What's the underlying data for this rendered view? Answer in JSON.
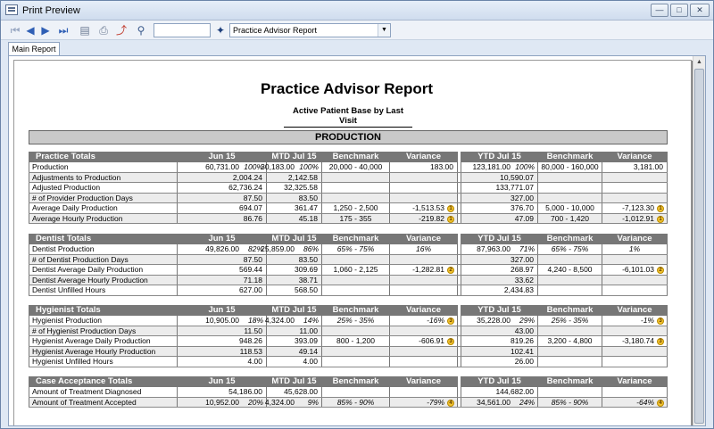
{
  "window": {
    "title": "Print Preview",
    "min_icon": "minimize-icon",
    "max_icon": "maximize-icon",
    "close_icon": "close-icon",
    "min_glyph": "—",
    "max_glyph": "□",
    "close_glyph": "✕"
  },
  "toolbar": {
    "icons": [
      "first-page-icon",
      "previous-page-icon",
      "next-page-icon",
      "last-page-icon",
      "page-setup-icon",
      "print-icon",
      "export-icon",
      "find-icon",
      "report-icon"
    ],
    "glyphs": {
      "first": "⏮",
      "prev": "◀",
      "next": "▶",
      "last": "⏭",
      "page": "▤",
      "print": "⎙",
      "export": "⤴",
      "find": "⚲",
      "report": "✦"
    },
    "page_value": "",
    "report_select": "Practice Advisor Report",
    "dropdown_glyph": "▼"
  },
  "tabs": [
    {
      "label": "Main Report"
    }
  ],
  "report": {
    "title": "Practice Advisor Report",
    "subtitle": "Active Patient Base by Last Visit",
    "banner": "PRODUCTION",
    "warning_color": "#f4c430",
    "sections": [
      {
        "name": "Practice Totals",
        "cols": [
          "Jun 15",
          "MTD Jul 15",
          "Benchmark",
          "Variance",
          "YTD Jul 15",
          "Benchmark",
          "Variance"
        ],
        "rows": [
          {
            "label": "Production",
            "jun": "60,731.00",
            "jun_pct": "100%",
            "mtd": "30,183.00",
            "mtd_pct": "100%",
            "bench": "20,000 - 40,000",
            "var": "183.00",
            "var_icon": "",
            "ytd": "123,181.00",
            "ytd_pct": "100%",
            "ybench": "80,000 - 160,000",
            "yvar": "3,181.00",
            "yvar_icon": ""
          },
          {
            "label": "Adjustments to Production",
            "jun": "2,004.24",
            "mtd": "2,142.58",
            "ytd": "10,590.07"
          },
          {
            "label": "Adjusted Production",
            "jun": "62,736.24",
            "mtd": "32,325.58",
            "ytd": "133,771.07"
          },
          {
            "label": "# of Provider Production Days",
            "jun": "87.50",
            "mtd": "83.50",
            "ytd": "327.00"
          },
          {
            "label": "Average Daily Production",
            "jun": "694.07",
            "mtd": "361.47",
            "bench": "1,250 - 2,500",
            "var": "-1,513.53",
            "var_icon": "1",
            "ytd": "376.70",
            "ybench": "5,000 - 10,000",
            "yvar": "-7,123.30",
            "yvar_icon": "1"
          },
          {
            "label": "Average Hourly Production",
            "jun": "86.76",
            "mtd": "45.18",
            "bench": "175 - 355",
            "var": "-219.82",
            "var_icon": "1",
            "ytd": "47.09",
            "ybench": "700 - 1,420",
            "yvar": "-1,012.91",
            "yvar_icon": "1"
          }
        ]
      },
      {
        "name": "Dentist Totals",
        "cols": [
          "Jun 15",
          "MTD Jul 15",
          "Benchmark",
          "Variance",
          "YTD Jul 15",
          "Benchmark",
          "Variance"
        ],
        "rows": [
          {
            "label": "Dentist Production",
            "jun": "49,826.00",
            "jun_pct": "82%",
            "mtd": "25,859.00",
            "mtd_pct": "86%",
            "bench": "65% - 75%",
            "bench_it": true,
            "var": "16%",
            "var_it": true,
            "ytd": "87,963.00",
            "ytd_pct": "71%",
            "ybench": "65% - 75%",
            "ybench_it": true,
            "yvar": "1%",
            "yvar_it": true
          },
          {
            "label": "# of Dentist Production Days",
            "jun": "87.50",
            "mtd": "83.50",
            "ytd": "327.00"
          },
          {
            "label": "Dentist Average Daily Production",
            "jun": "569.44",
            "mtd": "309.69",
            "bench": "1,060 - 2,125",
            "var": "-1,282.81",
            "var_icon": "2",
            "ytd": "268.97",
            "ybench": "4,240 - 8,500",
            "yvar": "-6,101.03",
            "yvar_icon": "2"
          },
          {
            "label": "Dentist Average Hourly Production",
            "jun": "71.18",
            "mtd": "38.71",
            "ytd": "33.62"
          },
          {
            "label": "Dentist Unfilled Hours",
            "jun": "627.00",
            "mtd": "568.50",
            "ytd": "2,434.83"
          }
        ]
      },
      {
        "name": "Hygienist Totals",
        "cols": [
          "Jun 15",
          "MTD Jul 15",
          "Benchmark",
          "Variance",
          "YTD Jul 15",
          "Benchmark",
          "Variance"
        ],
        "rows": [
          {
            "label": "Hygienist Production",
            "jun": "10,905.00",
            "jun_pct": "18%",
            "mtd": "4,324.00",
            "mtd_pct": "14%",
            "bench": "25% - 35%",
            "bench_it": true,
            "var": "-16%",
            "var_it": true,
            "var_icon": "3",
            "ytd": "35,228.00",
            "ytd_pct": "29%",
            "ybench": "25% - 35%",
            "ybench_it": true,
            "yvar": "-1%",
            "yvar_it": true,
            "yvar_icon": "3"
          },
          {
            "label": "# of Hygienist Production Days",
            "jun": "11.50",
            "mtd": "11.00",
            "ytd": "43.00"
          },
          {
            "label": "Hygienist Average Daily Production",
            "jun": "948.26",
            "mtd": "393.09",
            "bench": "800 - 1,200",
            "var": "-606.91",
            "var_icon": "3",
            "ytd": "819.26",
            "ybench": "3,200 - 4,800",
            "yvar": "-3,180.74",
            "yvar_icon": "3"
          },
          {
            "label": "Hygienist Average Hourly Production",
            "jun": "118.53",
            "mtd": "49.14",
            "ytd": "102.41"
          },
          {
            "label": "Hygienist Unfilled Hours",
            "jun": "4.00",
            "mtd": "4.00",
            "ytd": "26.00"
          }
        ]
      },
      {
        "name": "Case Acceptance Totals",
        "cols": [
          "Jun 15",
          "MTD Jul 15",
          "Benchmark",
          "Variance",
          "YTD Jul 15",
          "Benchmark",
          "Variance"
        ],
        "rows": [
          {
            "label": "Amount of Treatment Diagnosed",
            "jun": "54,186.00",
            "mtd": "45,628.00",
            "ytd": "144,682.00"
          },
          {
            "label": "Amount of Treatment Accepted",
            "jun": "10,952.00",
            "jun_pct": "20%",
            "mtd": "4,324.00",
            "mtd_pct": "9%",
            "bench": "85% - 90%",
            "bench_it": true,
            "var": "-79%",
            "var_it": true,
            "var_icon": "4",
            "ytd": "34,561.00",
            "ytd_pct": "24%",
            "ybench": "85% - 90%",
            "ybench_it": true,
            "yvar": "-64%",
            "yvar_it": true,
            "yvar_icon": "4"
          }
        ]
      }
    ]
  }
}
